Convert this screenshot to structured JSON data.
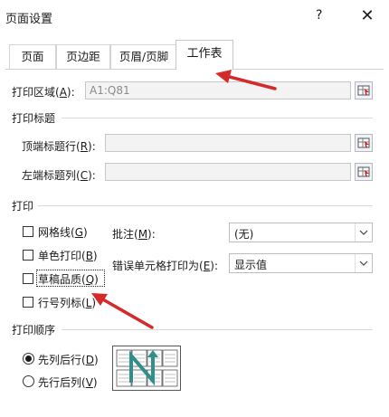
{
  "window": {
    "title": "页面设置",
    "help_label": "?",
    "close_label": "✕"
  },
  "tabs": [
    {
      "label": "页面",
      "active": false
    },
    {
      "label": "页边距",
      "active": false
    },
    {
      "label": "页眉/页脚",
      "active": false
    },
    {
      "label": "工作表",
      "active": true
    }
  ],
  "print_area": {
    "label": "打印区域(",
    "accel": "A",
    "label_end": "):",
    "value": "A1:Q81"
  },
  "print_titles": {
    "group_label": "打印标题",
    "rows": {
      "label": "顶端标题行(",
      "accel": "R",
      "label_end": "):",
      "value": ""
    },
    "cols": {
      "label": "左端标题列(",
      "accel": "C",
      "label_end": "):",
      "value": ""
    }
  },
  "print": {
    "group_label": "打印",
    "checkboxes": [
      {
        "label": "网格线(",
        "accel": "G",
        "label_end": ")",
        "checked": false
      },
      {
        "label": "单色打印(",
        "accel": "B",
        "label_end": ")",
        "checked": false
      },
      {
        "label": "草稿品质(",
        "accel": "Q",
        "label_end": ")",
        "checked": false
      },
      {
        "label": "行号列标(",
        "accel": "L",
        "label_end": ")",
        "checked": false
      }
    ],
    "comments": {
      "label": "批注(",
      "accel": "M",
      "label_end": "):",
      "value": "(无)"
    },
    "errors": {
      "label": "错误单元格打印为(",
      "accel": "E",
      "label_end": "):",
      "value": "显示值"
    }
  },
  "page_order": {
    "group_label": "打印顺序",
    "options": [
      {
        "label": "先列后行(",
        "accel": "D",
        "label_end": ")",
        "selected": true
      },
      {
        "label": "先行后列(",
        "accel": "V",
        "label_end": ")",
        "selected": false
      }
    ]
  },
  "colors": {
    "annotation_arrow": "#d42a2a",
    "order_arrow": "#2f8f8a"
  }
}
